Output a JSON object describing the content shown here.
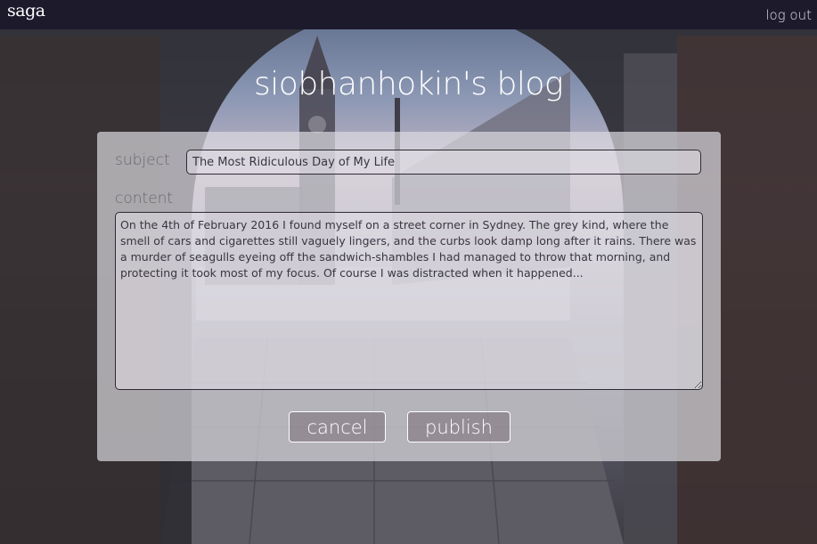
{
  "header": {
    "logo_text": "saga",
    "logout_label": "log out"
  },
  "blog": {
    "title": "siobhanhokin's blog"
  },
  "form": {
    "subject_label": "subject",
    "subject_value": "The Most Ridiculous Day of My Life",
    "content_label": "content",
    "content_value": "On the 4th of February 2016 I found myself on a street corner in Sydney. The grey kind, where the smell of cars and cigarettes still vaguely lingers, and the curbs look damp long after it rains. There was a murder of seagulls eyeing off the sandwich-shambles I had managed to throw that morning, and protecting it took most of my focus. Of course I was distracted when it happened...",
    "cancel_label": "cancel",
    "publish_label": "publish"
  },
  "colors": {
    "topbar": "#1d1a2c",
    "panel": "#dcdae0",
    "border": "#2e2a34"
  }
}
